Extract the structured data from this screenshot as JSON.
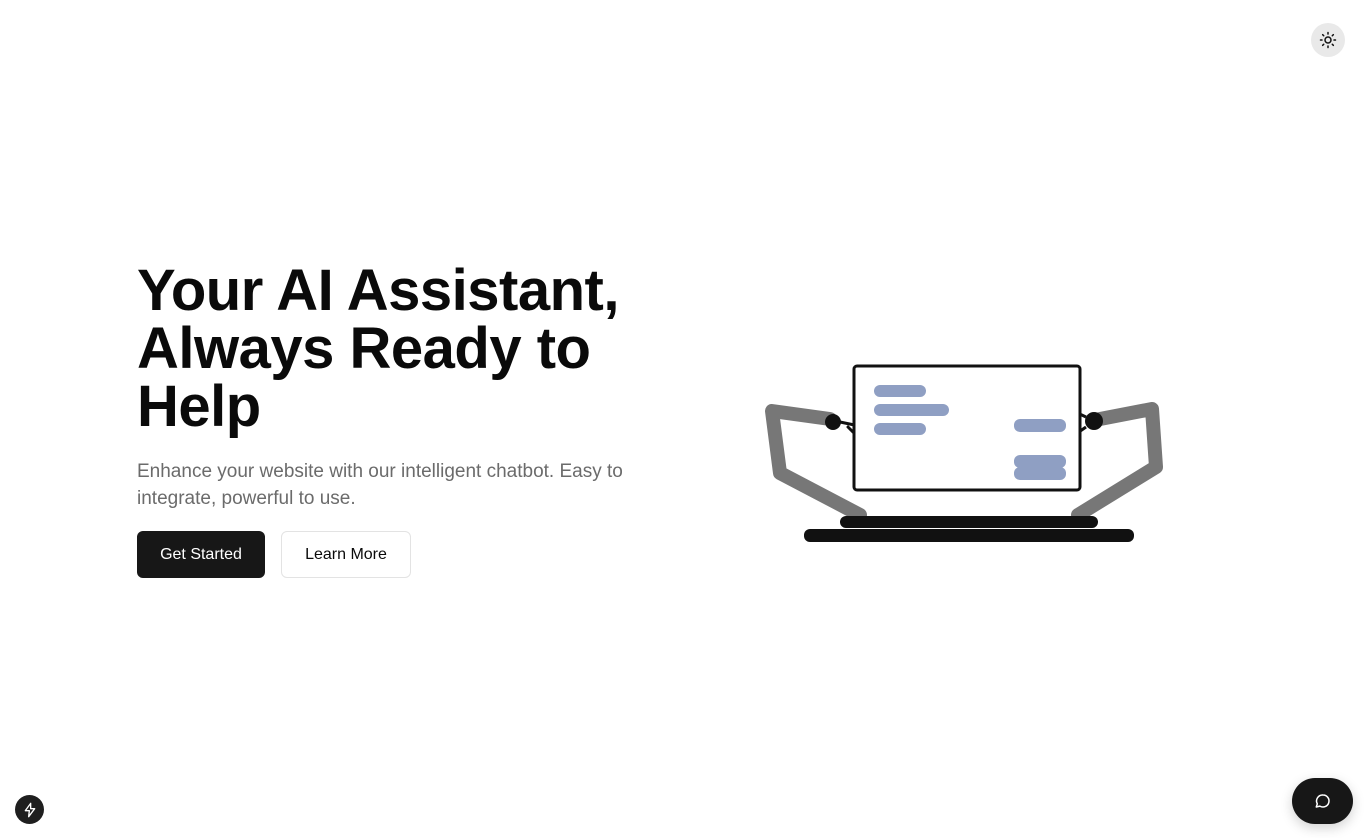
{
  "header": {
    "theme_toggle_icon": "sun-icon"
  },
  "hero": {
    "title_lines": [
      "Your AI Assistant,",
      "Always Ready to",
      "Help"
    ],
    "subtitle": "Enhance your website with our intelligent chatbot. Easy to integrate, powerful to use.",
    "primary_button": "Get Started",
    "secondary_button": "Learn More"
  },
  "illustration": {
    "icon": "robot-arms-chat-illustration",
    "accent_color": "#8f9fc3"
  },
  "footer": {
    "badge_icon": "lightning-icon",
    "chat_launcher_icon": "chat-bubble-icon"
  },
  "colors": {
    "primary": "#171717",
    "background": "#ffffff",
    "muted_text": "#6b6b6b"
  }
}
